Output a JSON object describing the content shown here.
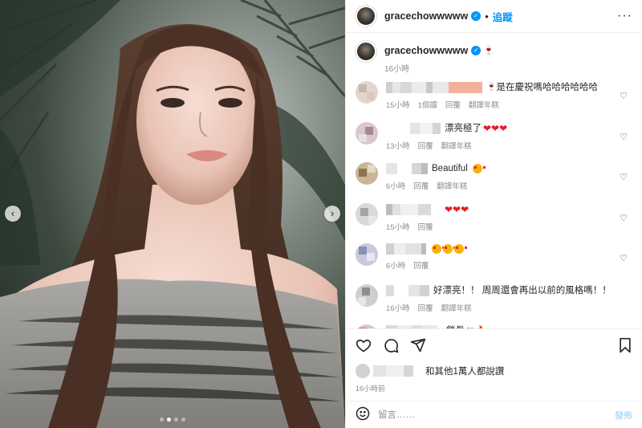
{
  "header": {
    "username": "gracechowwwww",
    "separator": "•",
    "follow_label": "追蹤",
    "more_label": "···"
  },
  "caption": {
    "username": "gracechowwwww",
    "emoji": "🍷",
    "time": "16小時"
  },
  "comments": [
    {
      "text": "是在慶祝嗎哈哈哈哈哈哈",
      "prefix_emoji": "🍷",
      "time": "15小時",
      "likes": "1個讚",
      "reply": "回覆",
      "translate": "翻譯年糕"
    },
    {
      "text": "漂亮極了",
      "time": "13小時",
      "reply": "回覆",
      "translate": "翻譯年糕",
      "hearts": 3
    },
    {
      "text": "Beautiful",
      "time": "6小時",
      "reply": "回覆",
      "translate": "翻譯年糕",
      "faces": 1
    },
    {
      "text": "",
      "time": "15小時",
      "reply": "回覆",
      "hearts": 3
    },
    {
      "text": "",
      "time": "6小時",
      "reply": "回覆",
      "faces": 3
    },
    {
      "text": "好漂亮！！ 周周還會再出以前的風格嗎！！",
      "time": "16小時",
      "reply": "回覆",
      "translate": "翻譯年糕"
    },
    {
      "text": "鎖骨",
      "time": "",
      "hearts": 1,
      "fire": 1
    }
  ],
  "likes": {
    "text": "和其他1萬人都說讚",
    "time": "16小時前"
  },
  "add_comment": {
    "placeholder": "留言……",
    "post_label": "發佈"
  },
  "carousel": {
    "prev": "‹",
    "next": "›",
    "dots": 4,
    "active_dot": 1
  },
  "colors": {
    "accent": "#0095f6",
    "post_disabled": "#b2dffc",
    "muted": "#8e8e8e",
    "heart": "#ed1c24"
  },
  "icons": [
    "heart-icon",
    "comment-icon",
    "share-icon",
    "bookmark-icon",
    "emoji-icon",
    "verified-icon",
    "more-icon"
  ]
}
